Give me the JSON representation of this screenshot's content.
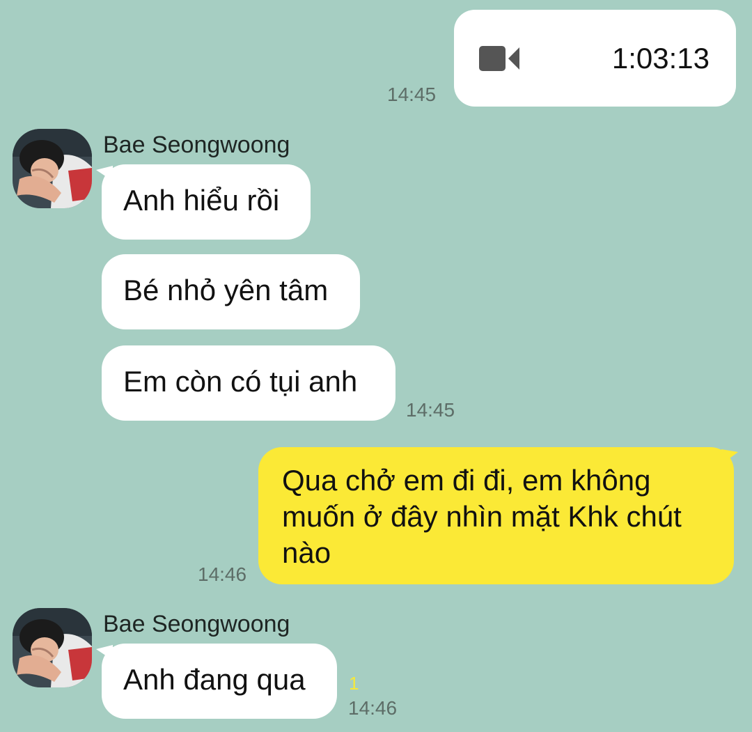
{
  "messages": [
    {
      "type": "video_call",
      "direction": "outgoing",
      "icon": "video-camera-icon",
      "duration": "1:03:13",
      "time": "14:45"
    },
    {
      "type": "group",
      "direction": "incoming",
      "sender": "Bae Seongwoong",
      "avatar": "avatar-bae-seongwoong",
      "bubbles": [
        "Anh hiểu rồi",
        "Bé nhỏ yên tâm",
        "Em còn có tụi anh"
      ],
      "time": "14:45"
    },
    {
      "type": "text",
      "direction": "outgoing",
      "lines": [
        "Qua chở em đi đi, em không",
        "muốn ở đây nhìn mặt Khk chút",
        "nào"
      ],
      "time": "14:46"
    },
    {
      "type": "group",
      "direction": "incoming",
      "sender": "Bae Seongwoong",
      "avatar": "avatar-bae-seongwoong",
      "bubbles": [
        "Anh đang qua"
      ],
      "unread_count": "1",
      "time": "14:46"
    }
  ],
  "colors": {
    "background": "#a6cec2",
    "outgoing_bubble": "#fbe936",
    "incoming_bubble": "#ffffff",
    "timestamp": "#5d6d67",
    "unread": "#f6e93a"
  }
}
